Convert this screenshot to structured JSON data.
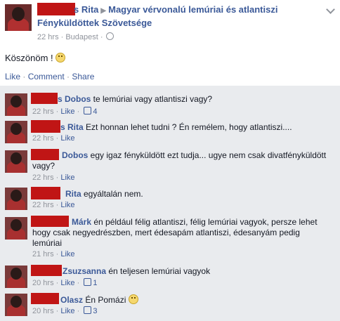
{
  "post": {
    "author_suffix": "s Rita",
    "group_line1": "Magyar vérvonalú lemúriai és atlantiszi",
    "group_line2": "Fényküldöttek Szövetsége",
    "time": "22 hrs · Budapest ·",
    "text": "Köszönöm !",
    "actions": {
      "like": "Like",
      "sep1": " · ",
      "comment": "Comment",
      "sep2": " · ",
      "share": "Share"
    }
  },
  "comments": [
    {
      "name": "s Dobos",
      "text": " te lemúriai vagy atlantiszi vagy?",
      "time": "22 hrs",
      "like": "Like",
      "likes": "4"
    },
    {
      "name": "s Rita",
      "text": " Ezt honnan lehet tudni ? Én remélem, hogy atlantiszi....",
      "time": "22 hrs",
      "like": "Like",
      "likes": ""
    },
    {
      "name": "Dobos",
      "text": " egy igaz fényküldött ezt tudja... ugye nem csak divatfényküldött vagy?",
      "time": "22 hrs",
      "like": "Like",
      "likes": ""
    },
    {
      "name": "Rita",
      "text": " egyáltalán nem.",
      "time": "22 hrs",
      "like": "Like",
      "likes": ""
    },
    {
      "name": "Márk",
      "text": " én például félig atlantiszi, félig lemúriai vagyok, persze lehet hogy csak negyedrészben, mert édesapám atlantiszi, édesanyám pedig lemúriai",
      "time": "21 hrs",
      "like": "Like",
      "likes": ""
    },
    {
      "name": "Zsuzsanna",
      "text": " én teljesen lemúriai vagyok",
      "time": "20 hrs",
      "like": "Like",
      "likes": "1"
    },
    {
      "name": "Olasz",
      "text": " Én Pomázi",
      "time": "20 hrs",
      "like": "Like",
      "likes": "3"
    }
  ]
}
